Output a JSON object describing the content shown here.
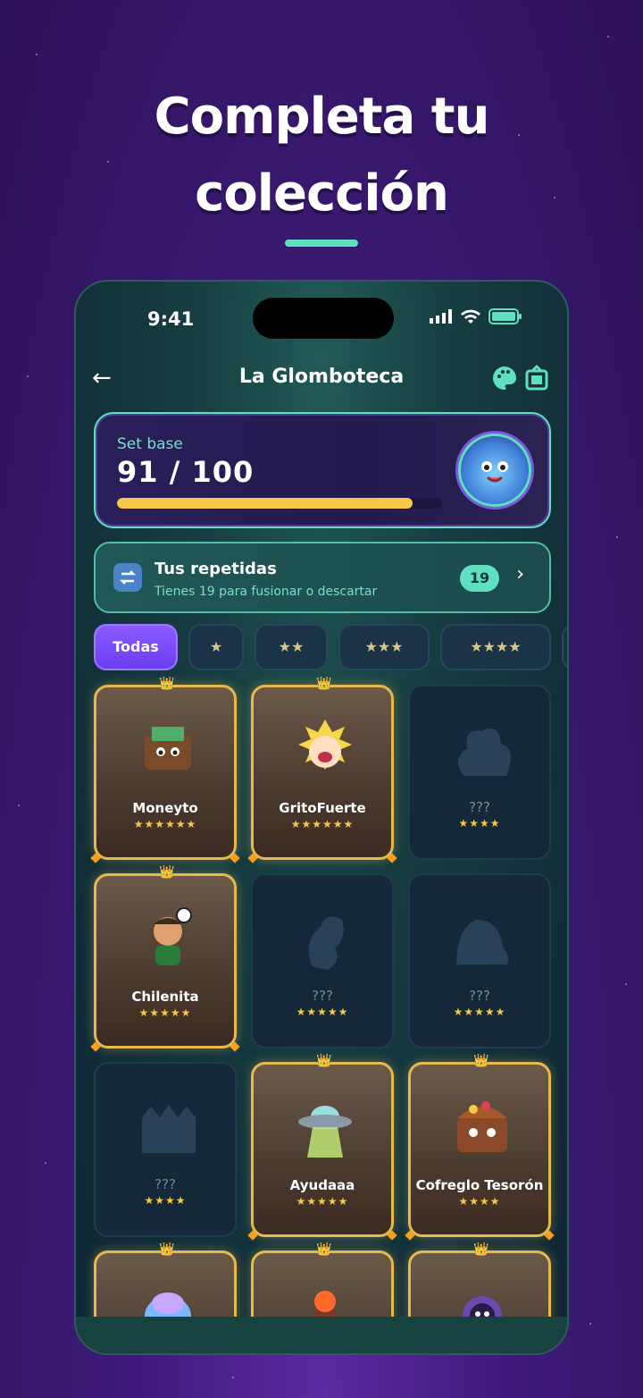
{
  "headline": {
    "line1": "Completa tu",
    "line2": "colección"
  },
  "status_bar": {
    "time": "9:41"
  },
  "nav": {
    "title": "La Glomboteca"
  },
  "set": {
    "label": "Set base",
    "count": "91 / 100",
    "progress": 0.91
  },
  "duplicates": {
    "title": "Tus repetidas",
    "subtitle": "Tienes 19 para fusionar o descartar",
    "badge": "19"
  },
  "filters": [
    {
      "label": "Todas"
    },
    {
      "label": "★"
    },
    {
      "label": "★★"
    },
    {
      "label": "★★★"
    },
    {
      "label": "★★★★"
    }
  ],
  "cards": [
    {
      "name": "Moneyto",
      "stars": "★★★★★★",
      "owned": true,
      "icon": "wallet"
    },
    {
      "name": "GritoFuerte",
      "stars": "★★★★★★",
      "owned": true,
      "icon": "shouting"
    },
    {
      "name": "???",
      "stars": "★★★★",
      "owned": false,
      "icon": ""
    },
    {
      "name": "Chilenita",
      "stars": "★★★★★",
      "owned": true,
      "icon": "footballer"
    },
    {
      "name": "???",
      "stars": "★★★★★",
      "owned": false,
      "icon": ""
    },
    {
      "name": "???",
      "stars": "★★★★★",
      "owned": false,
      "icon": ""
    },
    {
      "name": "???",
      "stars": "★★★★",
      "owned": false,
      "icon": ""
    },
    {
      "name": "Ayudaaa",
      "stars": "★★★★★",
      "owned": true,
      "icon": "ufo"
    },
    {
      "name": "Cofreglo Tesorón",
      "stars": "★★★★",
      "owned": true,
      "icon": "treasure"
    },
    {
      "name": "",
      "stars": "",
      "owned": true,
      "icon": "icecream"
    },
    {
      "name": "",
      "stars": "",
      "owned": true,
      "icon": "volcano"
    },
    {
      "name": "",
      "stars": "",
      "owned": true,
      "icon": "astronaut"
    }
  ]
}
